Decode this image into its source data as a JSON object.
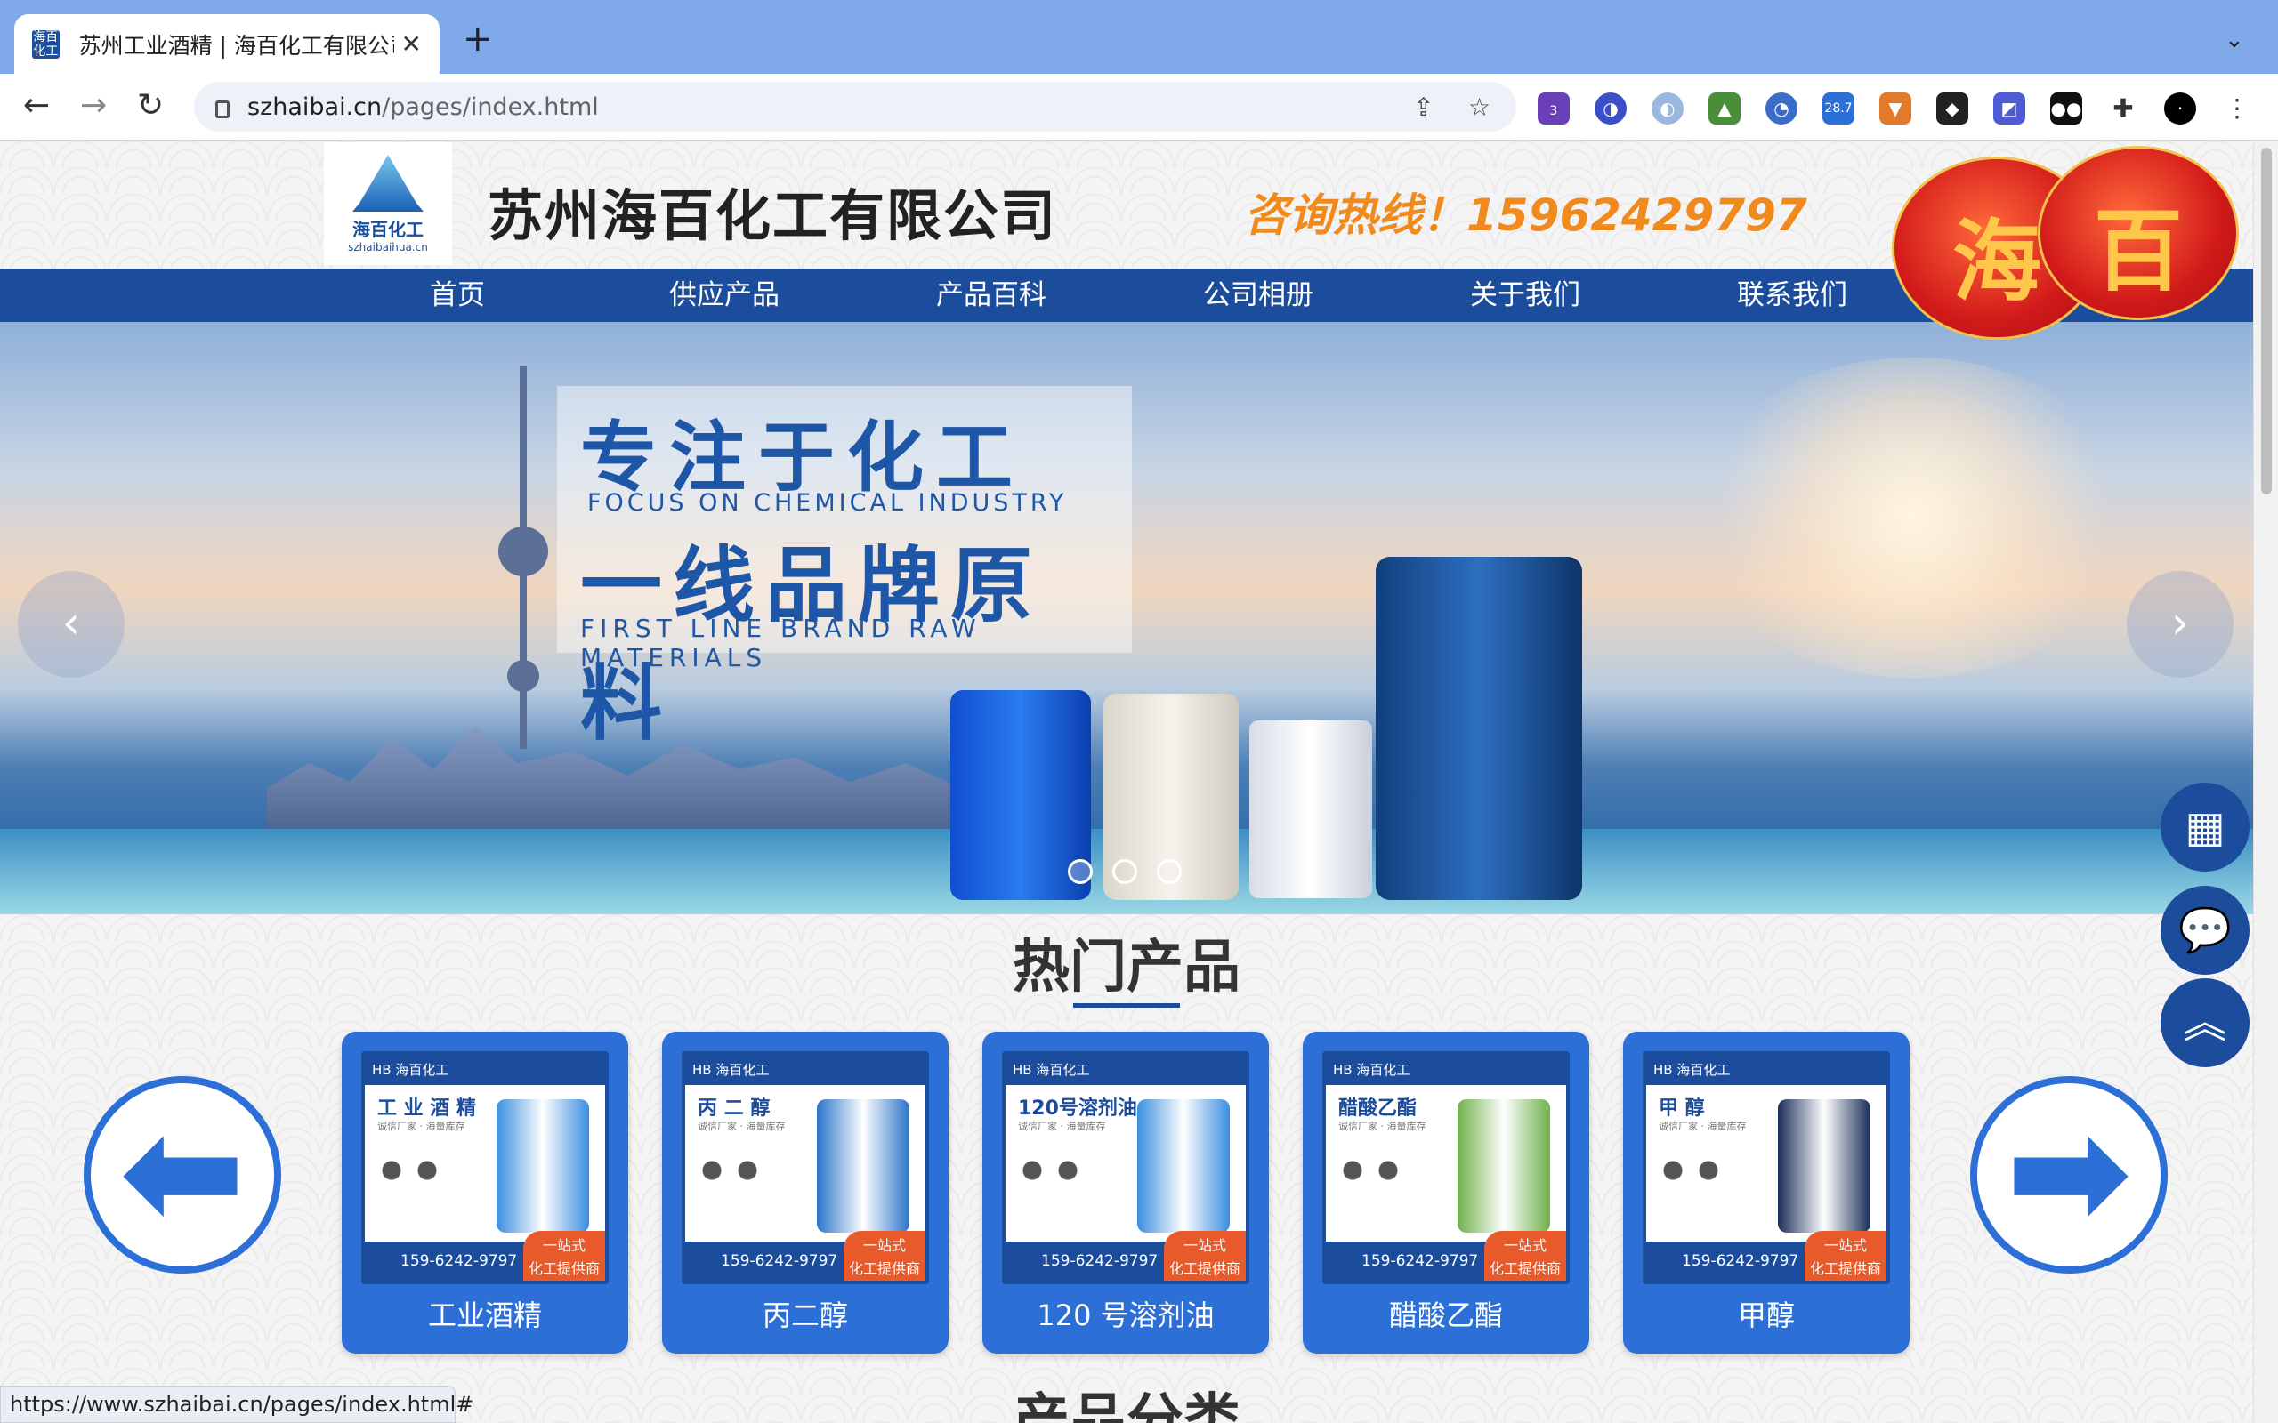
{
  "browser": {
    "tab_title": "苏州工业酒精 | 海百化工有限公司",
    "tab_favicon": "海百\n化工",
    "url_host": "szhaibai.cn",
    "url_path": "/pages/index.html",
    "ext_badge_count": "3",
    "ext_price": "28.7",
    "status_url": "https://www.szhaibai.cn/pages/index.html#"
  },
  "header": {
    "logo_cn": "海百化工",
    "logo_en": "szhaibaihua.cn",
    "company": "苏州海百化工有限公司",
    "hotline": "咨询热线！15962429797",
    "lantern_chars": [
      "海",
      "百"
    ]
  },
  "nav": [
    "首页",
    "供应产品",
    "产品百科",
    "公司相册",
    "关于我们",
    "联系我们"
  ],
  "banner": {
    "line1": "专注于化工",
    "line2": "FOCUS ON CHEMICAL INDUSTRY",
    "line3": "一线品牌原料",
    "line4": "FIRST LINE BRAND RAW MATERIALS",
    "prev_icon": "‹",
    "next_icon": "›"
  },
  "hot": {
    "title": "热门产品",
    "products": [
      {
        "label": "工业酒精",
        "img_title": "工 业 酒 精",
        "drum": "#3a8ee0"
      },
      {
        "label": "丙二醇",
        "img_title": "丙 二 醇",
        "drum": "#2b74c9"
      },
      {
        "label": "120 号溶剂油",
        "img_title": "120号溶剂油",
        "drum": "#3a8ee0"
      },
      {
        "label": "醋酸乙酯",
        "img_title": "醋酸乙酯",
        "drum": "#6fb04a"
      },
      {
        "label": "甲醇",
        "img_title": "甲  醇",
        "drum": "#1b2e5a"
      }
    ],
    "card_header": "HB 海百化工",
    "card_sub": "诚信厂家 · 海量库存",
    "card_phone": "159-6242-9797",
    "card_badge": "一站式\n化工提供商"
  },
  "category": {
    "title": "产品分类"
  },
  "colors": {
    "brand": "#1c4d9c",
    "accent": "#2c6fd6",
    "hotline": "#f08a1d"
  }
}
